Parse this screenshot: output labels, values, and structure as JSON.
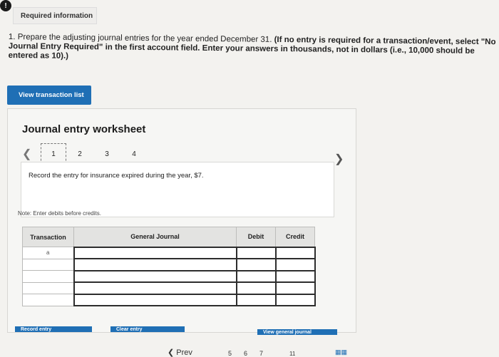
{
  "header": {
    "alert_icon": "!",
    "required_label": "Required information"
  },
  "instructions": {
    "number": "1.",
    "text_plain": "Prepare the adjusting journal entries for the year ended December 31.",
    "text_bold": "(If no entry is required for a transaction/event, select \"No Journal Entry Required\" in the first account field. Enter your answers in thousands, not in dollars (i.e., 10,000 should be entered as 10).)"
  },
  "view_transaction_list_label": "View transaction list",
  "worksheet": {
    "title": "Journal entry worksheet",
    "pages": [
      "1",
      "2",
      "3",
      "4"
    ],
    "current_page": "1",
    "entry_description": "Record the entry for insurance expired during the year, $7.",
    "note": "Note: Enter debits before credits."
  },
  "journal_table": {
    "headers": {
      "transaction": "Transaction",
      "general_journal": "General Journal",
      "debit": "Debit",
      "credit": "Credit"
    },
    "rows": [
      {
        "transaction": "a",
        "account": "",
        "debit": "",
        "credit": ""
      },
      {
        "transaction": "",
        "account": "",
        "debit": "",
        "credit": ""
      },
      {
        "transaction": "",
        "account": "",
        "debit": "",
        "credit": ""
      },
      {
        "transaction": "",
        "account": "",
        "debit": "",
        "credit": ""
      },
      {
        "transaction": "",
        "account": "",
        "debit": "",
        "credit": ""
      }
    ]
  },
  "buttons": {
    "record_entry": "Record entry",
    "clear_entry": "Clear entry",
    "view_general_journal": "View general journal"
  },
  "footer": {
    "prev_label": "Prev",
    "page_numbers": [
      "5",
      "6",
      "7",
      "11"
    ]
  }
}
